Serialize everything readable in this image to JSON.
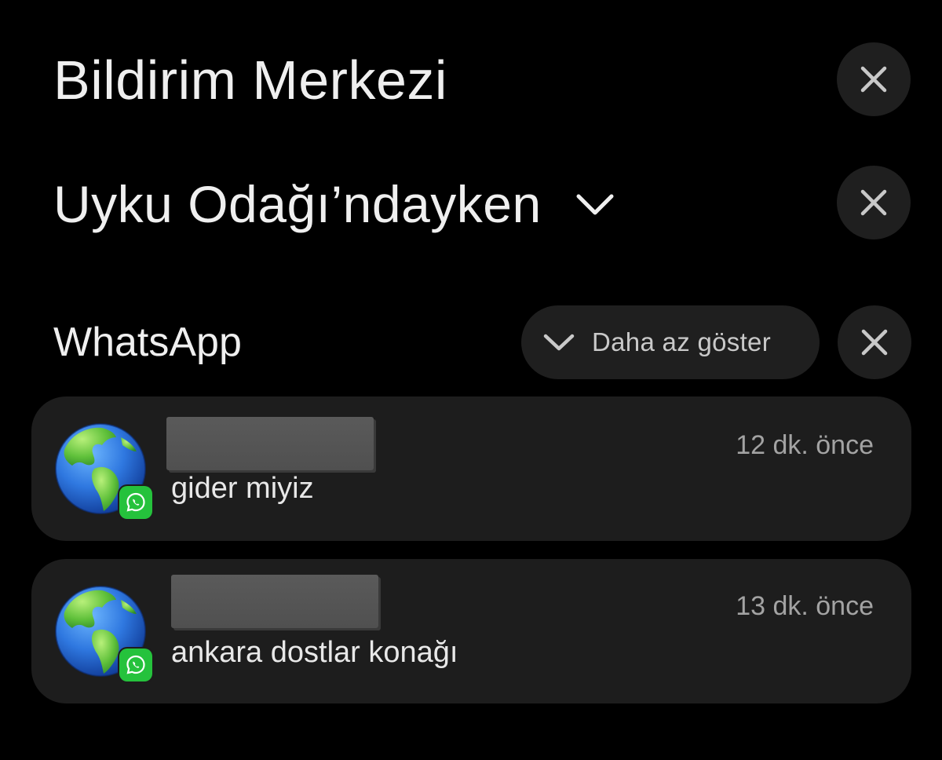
{
  "header": {
    "title": "Bildirim Merkezi"
  },
  "focus": {
    "label": "Uyku Odağı’ndayken"
  },
  "group": {
    "app_name": "WhatsApp",
    "show_less_label": "Daha az göster"
  },
  "notifications": [
    {
      "time": "12 dk. önce",
      "message": "gider miyiz",
      "sender_redacted": true,
      "avatar_icon": "globe-americas-icon",
      "badge_icon": "whatsapp-icon"
    },
    {
      "time": "13 dk. önce",
      "message": "ankara dostlar konağı",
      "sender_redacted": true,
      "avatar_icon": "globe-americas-icon",
      "badge_icon": "whatsapp-icon"
    }
  ],
  "colors": {
    "background": "#000000",
    "card": "#1d1d1d",
    "button": "#1f1f1f",
    "whatsapp_green": "#25c23c"
  }
}
